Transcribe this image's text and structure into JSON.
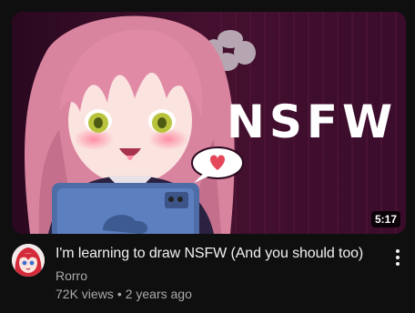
{
  "video": {
    "thumbnail_text": "NSFW",
    "duration": "5:17",
    "title": "I'm learning to draw NSFW (And you should too)",
    "channel": "Rorro",
    "views": "72K views",
    "separator": "•",
    "age": "2 years ago"
  },
  "icons": {
    "menu": "more-vert-icon",
    "avatar": "channel-avatar"
  },
  "colors": {
    "background": "#0f0f0f",
    "primary_text": "#f1f1f1",
    "secondary_text": "#aaaaaa",
    "thumbnail_bg": "#3c0b2c"
  }
}
